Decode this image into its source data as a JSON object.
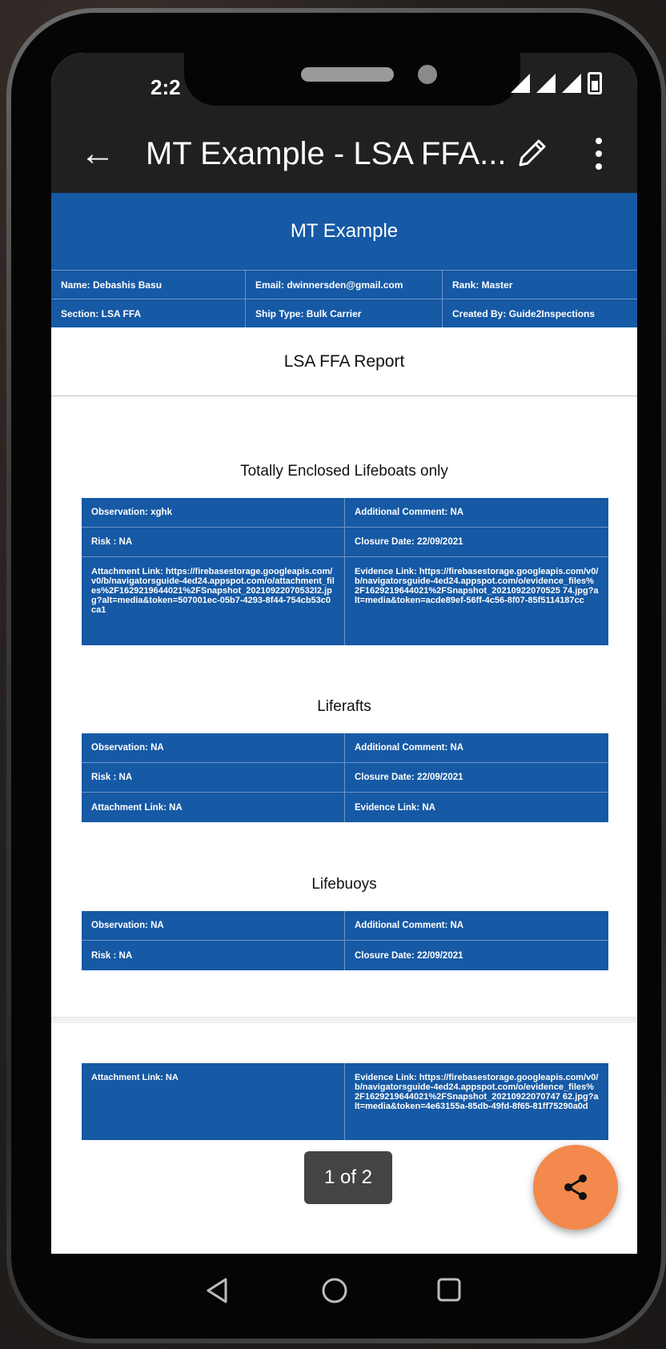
{
  "status": {
    "time": "2:2"
  },
  "appbar": {
    "title": "MT Example - LSA FFA..."
  },
  "doc": {
    "header": "MT Example",
    "info": [
      [
        "Name: Debashis Basu",
        "Email: dwinnersden@gmail.com",
        "Rank: Master"
      ],
      [
        "Section: LSA FFA",
        "Ship Type: Bulk Carrier",
        "Created By: Guide2Inspections"
      ]
    ],
    "report_title": "LSA FFA Report",
    "sections": [
      {
        "title": "Totally Enclosed Lifeboats only",
        "rows": [
          [
            "Observation: xghk",
            "Additional Comment: NA"
          ],
          [
            "Risk : NA",
            "Closure Date: 22/09/2021"
          ],
          [
            "Attachment Link: https://firebasestorage.googleapis.com/v0/b/navigatorsguide-4ed24.appspot.com/o/attachment_files%2F1629219644021%2FSnapshot_20210922070532l2.jpg?alt=media&token=507001ec-05b7-4293-8f44-754cb53c0ca1",
            "Evidence Link: https://firebasestorage.googleapis.com/v0/b/navigatorsguide-4ed24.appspot.com/o/evidence_files%2F1629219644021%2FSnapshot_20210922070525 74.jpg?alt=media&token=acde89ef-56ff-4c56-8f07-85f5114187cc"
          ]
        ]
      },
      {
        "title": "Liferafts",
        "rows": [
          [
            "Observation: NA",
            "Additional Comment: NA"
          ],
          [
            "Risk : NA",
            "Closure Date: 22/09/2021"
          ],
          [
            "Attachment Link: NA",
            "Evidence Link: NA"
          ]
        ]
      },
      {
        "title": "Lifebuoys",
        "rows": [
          [
            "Observation: NA",
            "Additional Comment: NA"
          ],
          [
            "Risk : NA",
            "Closure Date: 22/09/2021"
          ]
        ]
      }
    ],
    "page2_row": [
      "Attachment Link: NA",
      "Evidence Link: https://firebasestorage.googleapis.com/v0/b/navigatorsguide-4ed24.appspot.com/o/evidence_files%2F1629219644021%2FSnapshot_20210922070747 62.jpg?alt=media&token=4e63155a-85db-49fd-8f65-81ff75290a0d"
    ]
  },
  "page_indicator": "1 of 2",
  "icons": {
    "back": "arrow-left-icon",
    "edit": "pencil-icon",
    "more": "more-vertical-icon",
    "share": "share-icon",
    "nav_back": "triangle-back-icon",
    "nav_home": "circle-home-icon",
    "nav_recents": "square-recents-icon"
  },
  "colors": {
    "header_blue": "#1659a5",
    "fab": "#f3894c",
    "appbar": "#202020"
  }
}
